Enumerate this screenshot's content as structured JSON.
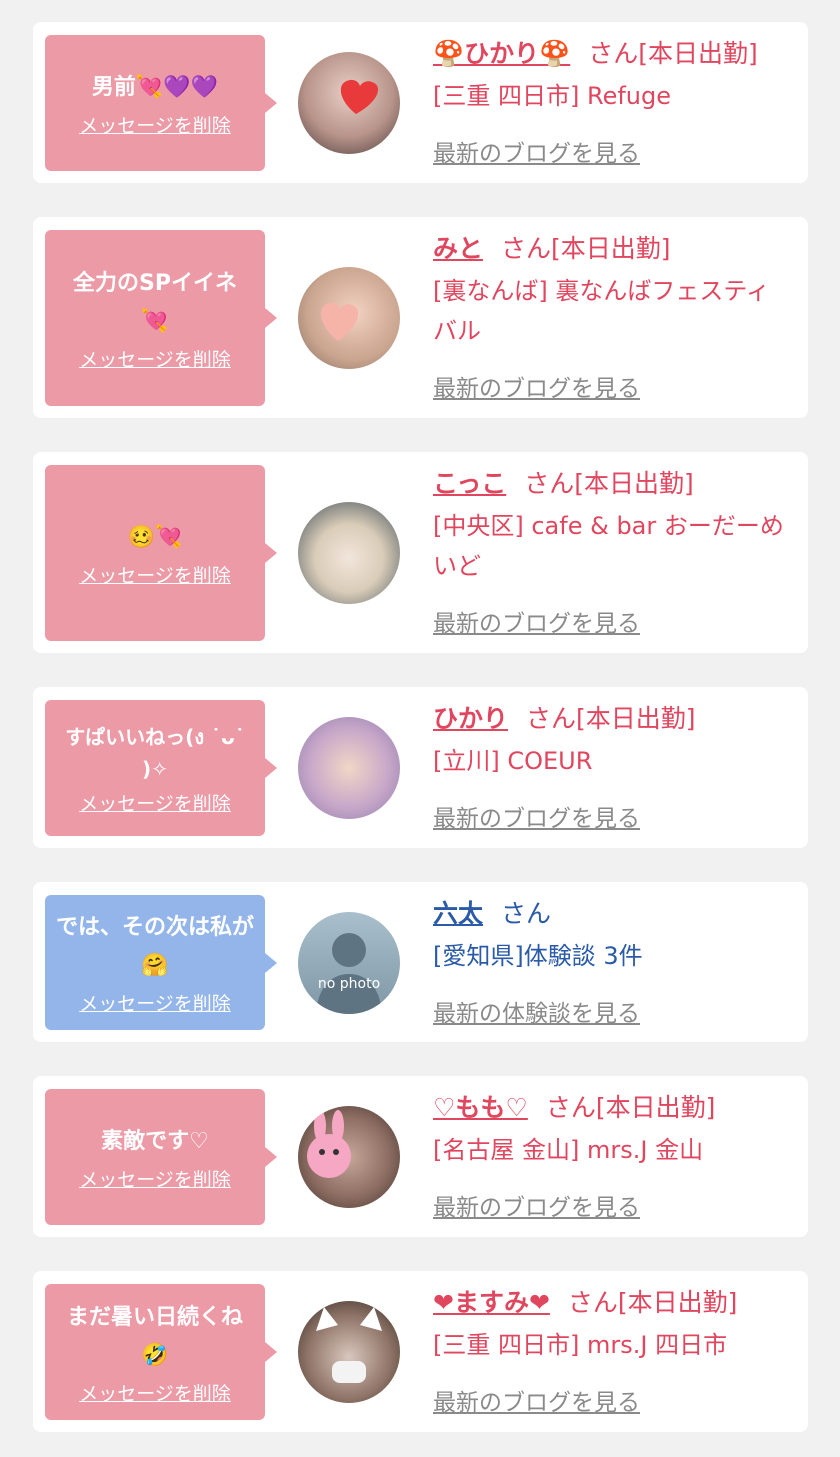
{
  "delete_label": "メッセージを削除",
  "colors": {
    "pink_bubble": "#eb9aa6",
    "blue_bubble": "#93b5ea",
    "pink_text": "#e0475f",
    "blue_text": "#2a5aa8",
    "link_gray": "#8a8a8a"
  },
  "cards": [
    {
      "message": "男前💘💜💜",
      "name": "🍄ひかり🍄",
      "san": "さん",
      "status": "[本日出勤]",
      "shop": "[三重 四日市] Refuge",
      "link": "最新のブログを見る"
    },
    {
      "message": "全力のSPイイネ\n💘",
      "name": "みと",
      "san": "さん",
      "status": "[本日出勤]",
      "shop": "[裏なんば] 裏なんばフェスティバル",
      "link": "最新のブログを見る"
    },
    {
      "message": "🥴💘",
      "name": "こっこ",
      "san": "さん",
      "status": "[本日出勤]",
      "shop": "[中央区] cafe & bar おーだーめいど",
      "link": "最新のブログを見る"
    },
    {
      "message": "すぱいいねっ(ง ˙ᴗ˙ )✧",
      "name": "ひかり",
      "san": "さん",
      "status": "[本日出勤]",
      "shop": "[立川] COEUR",
      "link": "最新のブログを見る"
    },
    {
      "message": "では、その次は私が🤗",
      "name": "六太",
      "san": "さん",
      "status": "",
      "shop": "[愛知県]体験談 3件",
      "link": "最新の体験談を見る",
      "avatar_text": "no photo"
    },
    {
      "message": "素敵です♡",
      "name": "♡もも♡",
      "san": "さん",
      "status": "[本日出勤]",
      "shop": "[名古屋 金山] mrs.J 金山",
      "link": "最新のブログを見る"
    },
    {
      "message": "まだ暑い日続くね\n🤣",
      "name": "❤ますみ❤",
      "san": "さん",
      "status": "[本日出勤]",
      "shop": "[三重 四日市] mrs.J 四日市",
      "link": "最新のブログを見る"
    }
  ]
}
